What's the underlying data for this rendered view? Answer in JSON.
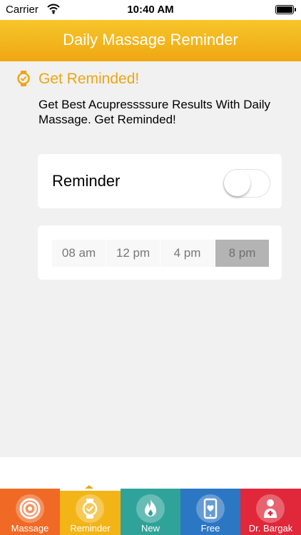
{
  "status_bar": {
    "carrier": "Carrier",
    "time": "10:40 AM"
  },
  "header": {
    "title": "Daily Massage Reminder"
  },
  "intro": {
    "title": "Get Reminded!",
    "description": "Get Best Acupressssure Results With Daily Massage. Get Reminded!"
  },
  "reminder": {
    "label": "Reminder",
    "enabled": false
  },
  "times": {
    "options": [
      "08 am",
      "12 pm",
      "4 pm",
      "8 pm"
    ],
    "selected": "8 pm"
  },
  "tabs": [
    {
      "label": "Massage",
      "icon": "target-icon",
      "color": "#f06a25"
    },
    {
      "label": "Reminder",
      "icon": "watch-icon",
      "color": "#f3b418",
      "active": true
    },
    {
      "label": "New",
      "icon": "flame-icon",
      "color": "#2fa39a"
    },
    {
      "label": "Free",
      "icon": "phone-heart-icon",
      "color": "#2b77c4"
    },
    {
      "label": "Dr. Bargak",
      "icon": "doctor-icon",
      "color": "#e0283a"
    }
  ],
  "colors": {
    "accent": "#eda512",
    "header": "#f3b418"
  }
}
